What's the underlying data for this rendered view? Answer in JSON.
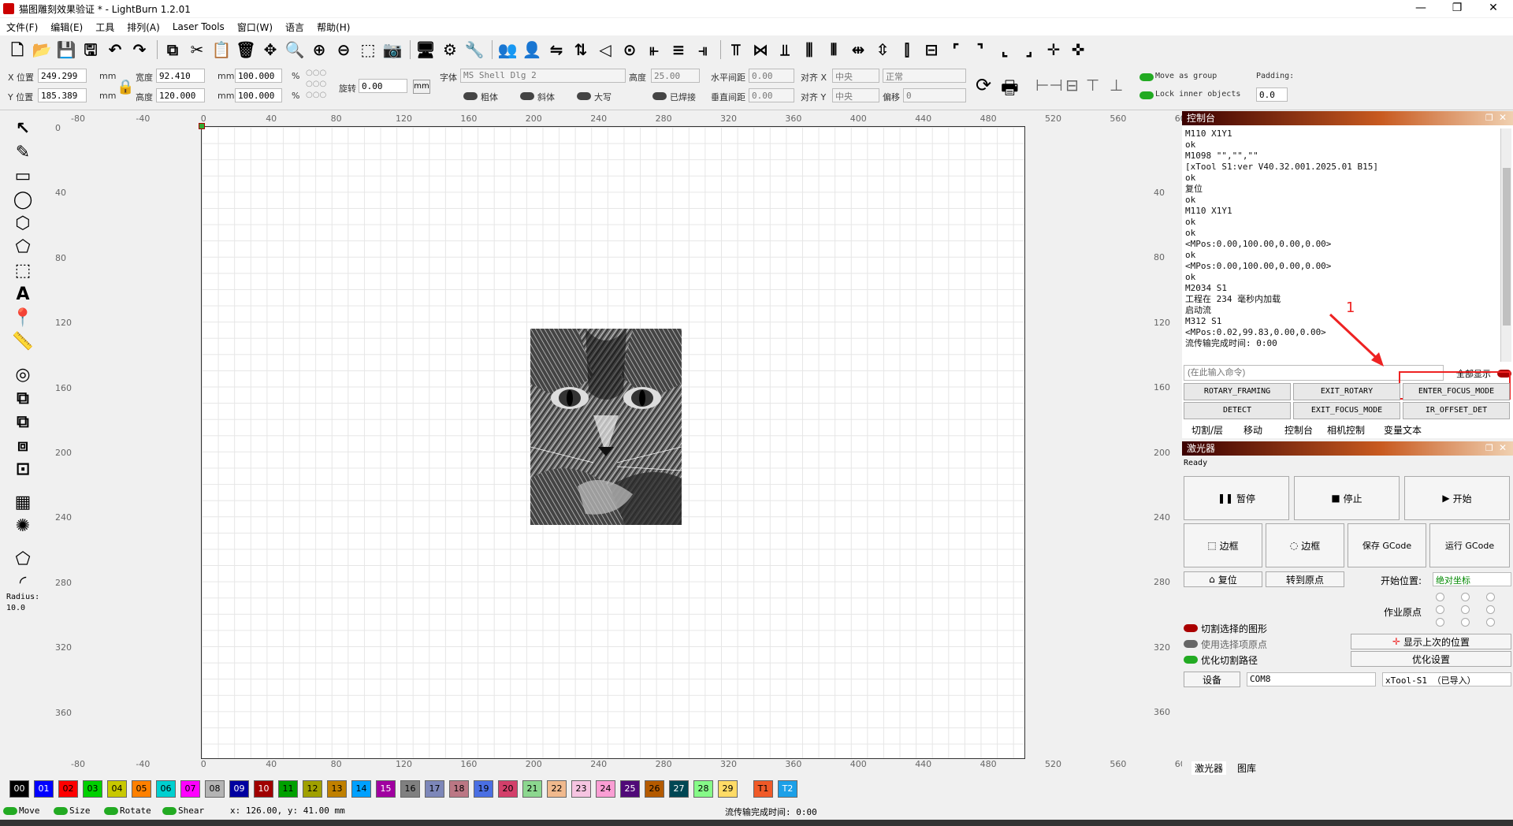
{
  "window": {
    "title": "猫图雕刻效果验证 * - LightBurn 1.2.01",
    "min": "—",
    "max": "❐",
    "close": "✕"
  },
  "menu": [
    "文件(F)",
    "编辑(E)",
    "工具",
    "排列(A)",
    "Laser Tools",
    "窗口(W)",
    "语言",
    "帮助(H)"
  ],
  "props": {
    "x_label": "X 位置",
    "x_val": "249.299",
    "y_label": "Y 位置",
    "y_val": "185.389",
    "unit": "mm",
    "w_label": "宽度",
    "w_val": "92.410",
    "h_label": "高度",
    "h_val": "120.000",
    "wp_val": "100.000",
    "hp_val": "100.000",
    "pct": "%",
    "rot_label": "旋转",
    "rot_val": "0.00",
    "mm_btn": "mm"
  },
  "text": {
    "font_label": "字体",
    "font_val": "MS Shell Dlg 2",
    "height_label": "高度",
    "height_val": "25.00",
    "hspace_label": "水平间距",
    "hspace_val": "0.00",
    "vspace_label": "垂直间距",
    "vspace_val": "0.00",
    "alignx_label": "对齐 X",
    "alignx_val": "中央",
    "aligny_label": "对齐 Y",
    "aligny_val": "中央",
    "style_val": "正常",
    "offset_label": "偏移",
    "offset_val": "0",
    "bold": "粗体",
    "italic": "斜体",
    "upper": "大写",
    "welded": "已焊接"
  },
  "group": {
    "move_as_group": "Move as group",
    "lock_inner": "Lock inner objects",
    "padding_label": "Padding:",
    "padding_val": "0.0"
  },
  "ruler_top": [
    "-80",
    "-40",
    "0",
    "40",
    "80",
    "120",
    "160",
    "200",
    "240",
    "280",
    "320",
    "360",
    "400",
    "440",
    "480",
    "520",
    "560",
    "60"
  ],
  "ruler_bottom": [
    "-80",
    "-40",
    "0",
    "40",
    "80",
    "120",
    "160",
    "200",
    "240",
    "280",
    "320",
    "360",
    "400",
    "440",
    "480",
    "520",
    "560",
    "60"
  ],
  "ruler_left": [
    "0",
    "40",
    "80",
    "120",
    "160",
    "200",
    "240",
    "280",
    "320",
    "360"
  ],
  "ruler_right": [
    "40",
    "80",
    "120",
    "160",
    "200",
    "240",
    "280",
    "320",
    "360"
  ],
  "left_tools": {
    "radius_label": "Radius:",
    "radius_val": "10.0"
  },
  "console": {
    "title": "控制台",
    "lines": [
      "M110 X1Y1",
      "ok",
      "M1098 \"\",\"\",\"\"",
      "[xTool S1:ver V40.32.001.2025.01 B15]",
      "ok",
      "复位",
      "ok",
      "M110 X1Y1",
      "ok",
      "ok",
      "<MPos:0.00,100.00,0.00,0.00>",
      "ok",
      "<MPos:0.00,100.00,0.00,0.00>",
      "ok",
      "M2034 S1",
      "工程在 234 毫秒内加载",
      "启动流",
      "M312 S1",
      "<MPos:0.02,99.83,0.00,0.00>",
      "流传输完成时间: 0:00"
    ],
    "cmd_placeholder": "(在此输入命令)",
    "show_all": "全部显示",
    "annotation": "1",
    "macros": [
      "ROTARY_FRAMING",
      "EXIT_ROTARY",
      "ENTER_FOCUS_MODE",
      "DETECT",
      "EXIT_FOCUS_MODE",
      "IR_OFFSET_DET"
    ],
    "tabs": [
      "切割/层",
      "移动",
      "控制台",
      "相机控制",
      "变量文本"
    ]
  },
  "laser": {
    "title": "激光器",
    "status": "Ready",
    "pause": "暂停",
    "stop": "停止",
    "start": "开始",
    "frame1": "边框",
    "frame2": "边框",
    "save_gcode": "保存 GCode",
    "run_gcode": "运行 GCode",
    "home": "复位",
    "goto_origin": "转到原点",
    "start_from_label": "开始位置:",
    "start_from_val": "绝对坐标",
    "job_origin_label": "作业原点",
    "cut_selected": "切割选择的图形",
    "use_selection_origin": "使用选择项原点",
    "optimize_path": "优化切割路径",
    "show_last_pos": "显示上次的位置",
    "optimize_settings": "优化设置",
    "devices": "设备",
    "port": "COM8",
    "device": "xTool-S1 （已导入）",
    "bottom_tabs": [
      "激光器",
      "图库"
    ]
  },
  "palette": [
    {
      "id": "00",
      "c": "#000000",
      "t": "#fff"
    },
    {
      "id": "01",
      "c": "#0000ff",
      "t": "#fff"
    },
    {
      "id": "02",
      "c": "#ff0000",
      "t": "#000"
    },
    {
      "id": "03",
      "c": "#00d000",
      "t": "#000"
    },
    {
      "id": "04",
      "c": "#c8c800",
      "t": "#000"
    },
    {
      "id": "05",
      "c": "#ff8000",
      "t": "#000"
    },
    {
      "id": "06",
      "c": "#00d0d0",
      "t": "#000"
    },
    {
      "id": "07",
      "c": "#ff00ff",
      "t": "#000"
    },
    {
      "id": "08",
      "c": "#b4b4b4",
      "t": "#000"
    },
    {
      "id": "09",
      "c": "#0000a0",
      "t": "#fff"
    },
    {
      "id": "10",
      "c": "#a00000",
      "t": "#fff"
    },
    {
      "id": "11",
      "c": "#00a000",
      "t": "#000"
    },
    {
      "id": "12",
      "c": "#a0a000",
      "t": "#000"
    },
    {
      "id": "13",
      "c": "#c08000",
      "t": "#000"
    },
    {
      "id": "14",
      "c": "#00a0ff",
      "t": "#000"
    },
    {
      "id": "15",
      "c": "#a000a0",
      "t": "#fff"
    },
    {
      "id": "16",
      "c": "#808080",
      "t": "#000"
    },
    {
      "id": "17",
      "c": "#7d87b9",
      "t": "#000"
    },
    {
      "id": "18",
      "c": "#bb7784",
      "t": "#000"
    },
    {
      "id": "19",
      "c": "#4a6fe3",
      "t": "#000"
    },
    {
      "id": "20",
      "c": "#d33f6a",
      "t": "#000"
    },
    {
      "id": "21",
      "c": "#8cd78f",
      "t": "#000"
    },
    {
      "id": "22",
      "c": "#f0b98d",
      "t": "#000"
    },
    {
      "id": "23",
      "c": "#f6c4e1",
      "t": "#000"
    },
    {
      "id": "24",
      "c": "#fa9ed4",
      "t": "#000"
    },
    {
      "id": "25",
      "c": "#500a78",
      "t": "#fff"
    },
    {
      "id": "26",
      "c": "#b45a00",
      "t": "#000"
    },
    {
      "id": "27",
      "c": "#004754",
      "t": "#fff"
    },
    {
      "id": "28",
      "c": "#86fa88",
      "t": "#000"
    },
    {
      "id": "29",
      "c": "#ffdb66",
      "t": "#000"
    },
    {
      "id": "T1",
      "c": "#f05a28",
      "t": "#000"
    },
    {
      "id": "T2",
      "c": "#1ca0e8",
      "t": "#fff"
    }
  ],
  "status": {
    "move": "Move",
    "size": "Size",
    "rotate": "Rotate",
    "shear": "Shear",
    "coords": "x: 126.00, y: 41.00 mm",
    "stream": "流传输完成时间: 0:00"
  }
}
